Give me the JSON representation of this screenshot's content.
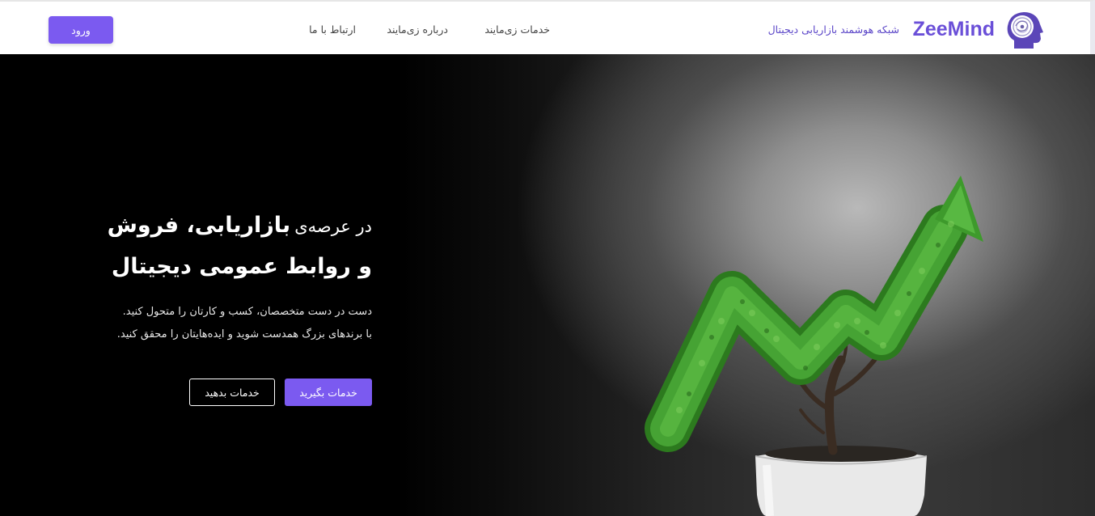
{
  "header": {
    "brand": {
      "name": "ZeeMind",
      "tagline": "شبکه هوشمند بازاریابی دیجیتال",
      "logo_icon": "head-profile-brain-icon"
    },
    "nav": [
      {
        "label": "خدمات زی‌مایند"
      },
      {
        "label": "درباره زی‌مایند"
      },
      {
        "label": "ارتباط با ما"
      }
    ],
    "login_label": "ورود"
  },
  "hero": {
    "headline": {
      "prefix": "در عرصه‌ی",
      "strong": "بازاریابی، فروش",
      "line2": "و روابط عمومی دیجیتال"
    },
    "description": [
      "دست در دست متخصصان، کسب و کارتان را متحول کنید.",
      "با برندهای بزرگ همدست شوید و ایده‌هایتان را محقق کنید."
    ],
    "primary_cta": "خدمات بگیرید",
    "secondary_cta": "خدمات بدهید",
    "image_subject": "potted-tree-growth-arrow-image"
  },
  "colors": {
    "accent": "#7b5af0",
    "brand_text": "#6a4fd8",
    "hero_background": "#000000",
    "foliage": "#3f9a2c"
  }
}
